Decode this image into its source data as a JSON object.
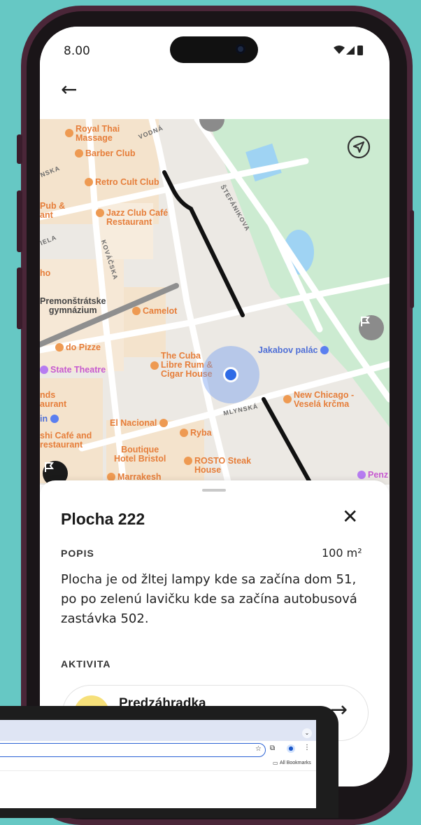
{
  "status_bar": {
    "time": "8.00"
  },
  "map": {
    "pois": [
      {
        "label": "Royal Thai\nMassage",
        "color": "orange"
      },
      {
        "label": "Barber Club",
        "color": "orange"
      },
      {
        "label": "Retro Cult Club",
        "color": "orange"
      },
      {
        "label": "Pub &\nant",
        "color": "orange"
      },
      {
        "label": "Jazz Club Café\nRestaurant",
        "color": "orange"
      },
      {
        "label": "ho",
        "color": "orange"
      },
      {
        "label": "Premonštrátske\ngymnázium",
        "color": "dark"
      },
      {
        "label": "Camelot",
        "color": "orange"
      },
      {
        "label": "do Pizze",
        "color": "orange"
      },
      {
        "label": "State Theatre",
        "color": "pink"
      },
      {
        "label": "The Cuba\nLibre Rum &\nCigar House",
        "color": "orange"
      },
      {
        "label": "Jakabov palác",
        "color": "blue"
      },
      {
        "label": "nds\naurant",
        "color": "orange"
      },
      {
        "label": "New Chicago -\nVeselá krčma",
        "color": "orange"
      },
      {
        "label": "in",
        "color": "blue"
      },
      {
        "label": "El Nacional",
        "color": "orange"
      },
      {
        "label": "Ryba",
        "color": "orange"
      },
      {
        "label": "shi Café and\nrestaurant",
        "color": "orange"
      },
      {
        "label": "Boutique\nHotel Bristol",
        "color": "orange"
      },
      {
        "label": "ROSTO Steak\nHouse",
        "color": "orange"
      },
      {
        "label": "Marrakesh",
        "color": "orange"
      },
      {
        "label": "Penz",
        "color": "pink"
      }
    ],
    "streets": [
      "VODNÁ",
      "NSKA",
      "ŠTEFÁNIKOVA",
      "KOVÁČSKA",
      "IELA",
      "MLYNSKÁ"
    ]
  },
  "sheet": {
    "title": "Plocha 222",
    "description_label": "POPIS",
    "area": "100 m²",
    "description": "Plocha je od žltej lampy kde sa začína dom 51, po  po zelenú lavičku kde sa začína autobusová zastávka 502.",
    "activity_label": "AKTIVITA",
    "activity_name": "Predzáhradka"
  },
  "laptop": {
    "bookmarks_label": "All Bookmarks"
  },
  "colors": {
    "background": "#66c8c4",
    "phone_frame": "#4a2638",
    "location": "#2f6be6",
    "poi": "#e67e3a"
  }
}
